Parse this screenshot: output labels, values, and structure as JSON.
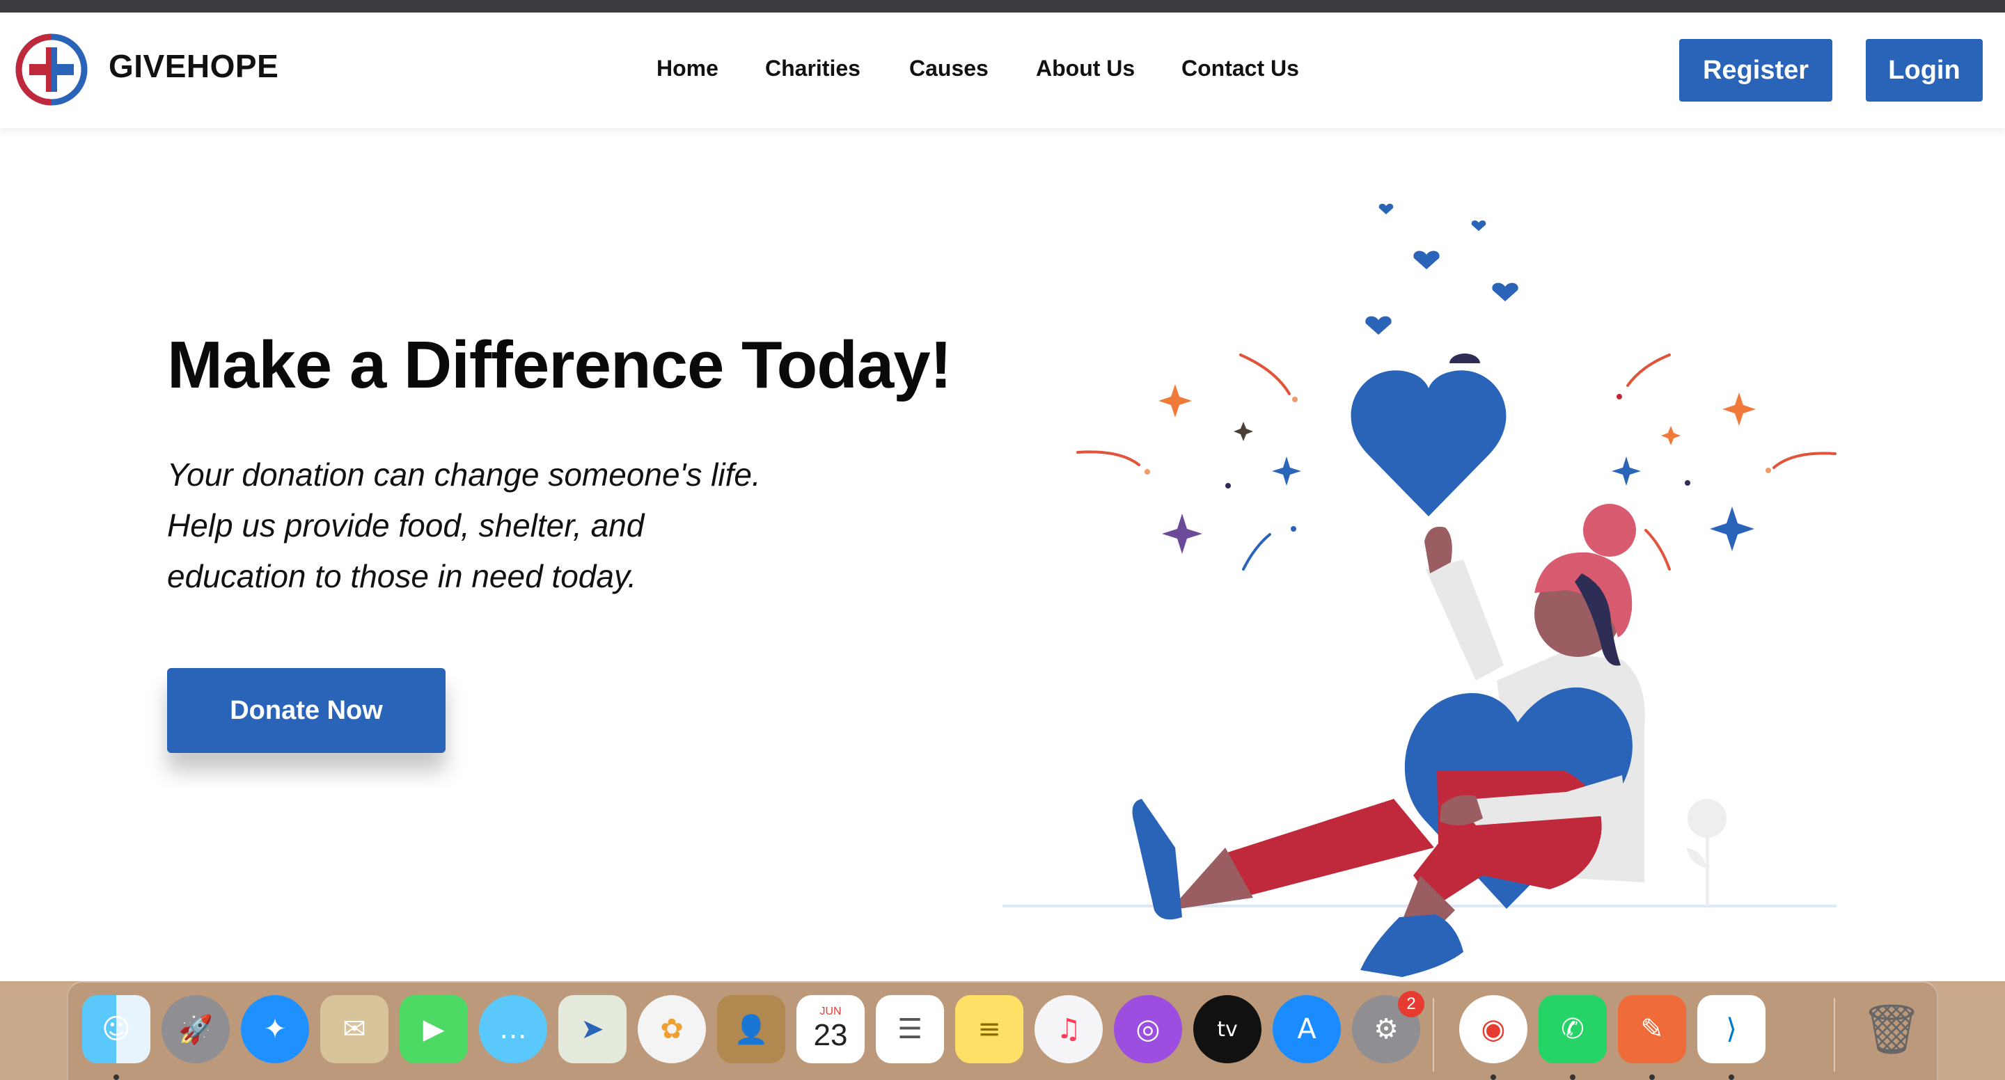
{
  "brand": {
    "name": "GIVEHOPE"
  },
  "nav": {
    "links": [
      "Home",
      "Charities",
      "Causes",
      "About Us",
      "Contact Us"
    ],
    "register_label": "Register",
    "login_label": "Login"
  },
  "hero": {
    "title": "Make a Difference Today!",
    "subtitle_lines": [
      "Your donation can change someone's life.",
      "Help us provide food, shelter, and",
      "education to those in need today."
    ],
    "cta_label": "Donate Now"
  },
  "calendar": {
    "month": "JUN",
    "day": "23"
  },
  "dock": {
    "settings_badge": "2"
  },
  "colors": {
    "primary": "#2a64b8",
    "accent_red": "#c0283c",
    "text": "#111111"
  }
}
